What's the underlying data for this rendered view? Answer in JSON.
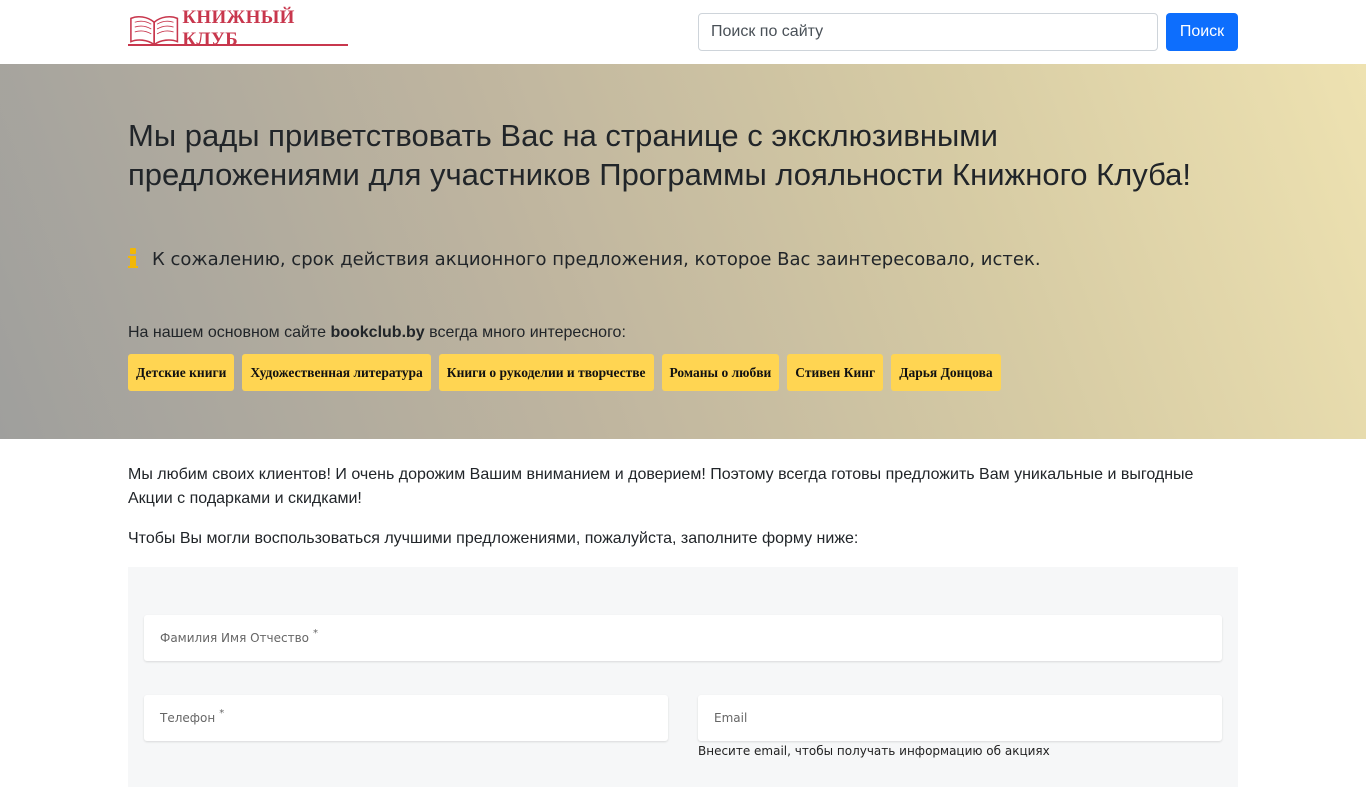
{
  "header": {
    "logo_text": "КНИЖНЫЙ КЛУБ",
    "search_placeholder": "Поиск по сайту",
    "search_button": "Поиск"
  },
  "hero": {
    "title": "Мы рады приветствовать Вас на странице с эксклюзивными предложениями для участников Программы лояльности Книжного Клуба!",
    "notice": "К сожалению, срок действия акционного предложения, которое Вас заинтересовало, истек.",
    "intro_prefix": "На нашем основном сайте ",
    "intro_site": "bookclub.by",
    "intro_suffix": " всегда много интересного:",
    "tags": [
      "Детские книги",
      "Художественная литература",
      "Книги о рукоделии и творчестве",
      "Романы о любви",
      "Стивен Кинг",
      "Дарья Донцова"
    ]
  },
  "content": {
    "paragraph1": "Мы любим своих клиентов! И очень дорожим Вашим вниманием и доверием! Поэтому всегда готовы предложить Вам уникальные и выгодные Акции с подарками и скидками!",
    "paragraph2": "Чтобы Вы могли воспользоваться лучшими предложениями, пожалуйста, заполните форму ниже:"
  },
  "form": {
    "fio_label": "Фамилия Имя Отчество",
    "phone_label": "Телефон",
    "email_label": "Email",
    "required_mark": "*",
    "email_hint": "Внесите email, чтобы получать информацию об акциях"
  },
  "colors": {
    "brand": "#c8374d",
    "primary_button": "#0d6efd",
    "tag_bg": "#ffd552",
    "info_icon": "#f2b705"
  }
}
